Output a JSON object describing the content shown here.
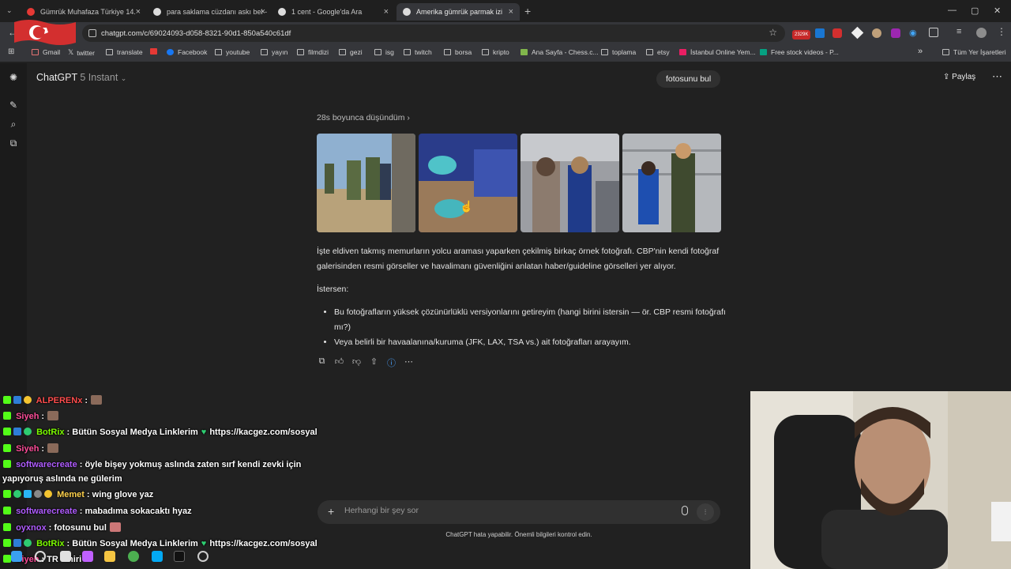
{
  "browser": {
    "tabs": [
      {
        "title": "Gümrük Muhafaza Türkiye 14.",
        "favicon_color": "#e53935",
        "active": false
      },
      {
        "title": "para saklama cüzdanı askı bel -",
        "favicon_color": "#dcdcdc",
        "active": false
      },
      {
        "title": "1 cent - Google'da Ara",
        "favicon_color": "#dcdcdc",
        "active": false
      },
      {
        "title": "Amerika gümrük parmak izi",
        "favicon_color": "#dcdcdc",
        "active": true
      }
    ],
    "close_glyph": "×",
    "new_tab_glyph": "+",
    "window_buttons": [
      "—",
      "▢",
      "✕"
    ],
    "url": "chatgpt.com/c/69024093-d058-8321-90d1-850a540c61df",
    "ext_badge": "2329K",
    "bookmarks": [
      "Gmail",
      "twitter",
      "translate",
      "",
      "Facebook",
      "youtube",
      "yayın",
      "filmdizi",
      "gezi",
      "isg",
      "twitch",
      "borsa",
      "kripto",
      "Ana Sayfa - Chess.c...",
      "toplama",
      "etsy",
      "İstanbul Online Yem...",
      "Free stock videos - P..."
    ],
    "bookmarks_overflow": "»",
    "all_bookmarks": "Tüm Yer İşaretleri"
  },
  "app": {
    "model_name": "ChatGPT",
    "model_variant": "5 Instant",
    "user_message": "fotosunu bul",
    "share_label": "Paylaş",
    "more_glyph": "⋯",
    "thought_label": "28s boyunca düşündüm",
    "thought_chevron": "›",
    "paragraph1": "İşte eldiven takmış memurların yolcu araması yaparken çekilmiş birkaç örnek fotoğrafı. CBP'nin kendi fotoğraf galerisinden resmi görseller ve havalimanı güvenliğini anlatan haber/guideline görselleri yer alıyor.",
    "paragraph2": "İstersen:",
    "bullets": [
      "Bu fotoğrafların yüksek çözünürlüklü versiyonlarını getireyim (hangi birini istersin — ör. CBP resmi fotoğrafı mı?)",
      "Veya belirli bir havaalanına/kuruma (JFK, LAX, TSA vs.) ait fotoğrafları arayayım."
    ],
    "composer_placeholder": "Herhangi bir şey sor",
    "composer_plus": "+",
    "disclaimer": "ChatGPT hata yapabilir. Önemli bilgileri kontrol edin."
  },
  "chat_overlay": [
    {
      "user": "ALPERENx",
      "color": "#ff4d4d",
      "text": ""
    },
    {
      "user": "Siyeh",
      "color": "#ff4d9a",
      "text": ""
    },
    {
      "user": "BotRix",
      "color": "#7cfc00",
      "text": "Bütün Sosyal Medya Linklerim",
      "link": "https://kacgez.com/sosyal"
    },
    {
      "user": "Siyeh",
      "color": "#ff4d9a",
      "text": ""
    },
    {
      "user": "softwarecreate",
      "color": "#b05cff",
      "text": "öyle bişey yokmuş aslında zaten sırf kendi zevki için",
      "text2": "yapıyoruş aslında ne gülerim"
    },
    {
      "user": "Memet",
      "color": "#ffd24d",
      "text": "wing glove yaz"
    },
    {
      "user": "softwarecreate",
      "color": "#b05cff",
      "text": "mabadıma sokacaktı hyaz"
    },
    {
      "user": "oyxnox",
      "color": "#b05cff",
      "text": "fotosunu bul"
    },
    {
      "user": "BotRix",
      "color": "#7cfc00",
      "text": "Bütün Sosyal Medya Linklerim",
      "link": "https://kacgez.com/sosyal"
    },
    {
      "user": "Siyeh",
      "color": "#ff4d9a",
      "text": "TR siniri"
    }
  ]
}
